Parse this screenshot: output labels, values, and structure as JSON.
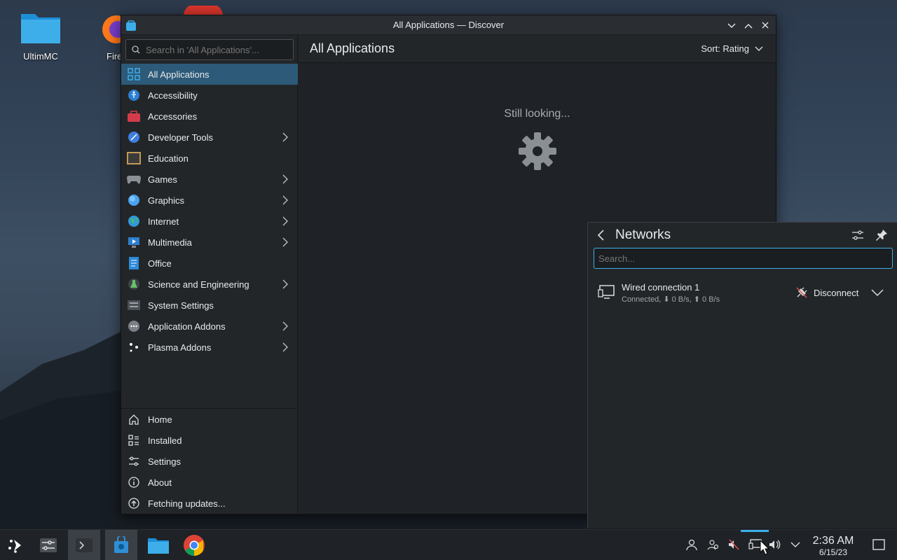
{
  "desktop": {
    "icons": [
      {
        "label": "UltimMC",
        "icon": "folder-icon"
      },
      {
        "label": "Fire",
        "icon": "firefox-icon"
      }
    ]
  },
  "window": {
    "title": "All Applications — Discover",
    "search_placeholder": "Search in 'All Applications'...",
    "categories": [
      {
        "label": "All Applications",
        "icon": "all-apps-icon",
        "submenu": false,
        "selected": true
      },
      {
        "label": "Accessibility",
        "icon": "accessibility-icon",
        "submenu": false
      },
      {
        "label": "Accessories",
        "icon": "accessories-icon",
        "submenu": false
      },
      {
        "label": "Developer Tools",
        "icon": "developer-tools-icon",
        "submenu": true
      },
      {
        "label": "Education",
        "icon": "education-icon",
        "submenu": false
      },
      {
        "label": "Games",
        "icon": "games-icon",
        "submenu": true
      },
      {
        "label": "Graphics",
        "icon": "graphics-icon",
        "submenu": true
      },
      {
        "label": "Internet",
        "icon": "internet-icon",
        "submenu": true
      },
      {
        "label": "Multimedia",
        "icon": "multimedia-icon",
        "submenu": true
      },
      {
        "label": "Office",
        "icon": "office-icon",
        "submenu": false
      },
      {
        "label": "Science and Engineering",
        "icon": "science-icon",
        "submenu": true
      },
      {
        "label": "System Settings",
        "icon": "system-settings-icon",
        "submenu": false
      },
      {
        "label": "Application Addons",
        "icon": "application-addons-icon",
        "submenu": true
      },
      {
        "label": "Plasma Addons",
        "icon": "plasma-addons-icon",
        "submenu": true
      }
    ],
    "bottom_nav": [
      {
        "label": "Home",
        "icon": "home-icon"
      },
      {
        "label": "Installed",
        "icon": "installed-icon"
      },
      {
        "label": "Settings",
        "icon": "settings-icon"
      },
      {
        "label": "About",
        "icon": "about-icon"
      },
      {
        "label": "Fetching updates...",
        "icon": "updates-icon"
      }
    ],
    "page_title": "All Applications",
    "sort_label": "Sort: Rating",
    "status_text": "Still looking..."
  },
  "networks": {
    "title": "Networks",
    "search_placeholder": "Search...",
    "connection": {
      "name": "Wired connection 1",
      "status": "Connected, ⬇ 0 B/s, ⬆ 0 B/s",
      "action": "Disconnect"
    }
  },
  "taskbar": {
    "time": "2:36 AM",
    "date": "6/15/23"
  },
  "colors": {
    "accent": "#3daee9",
    "selection": "#2d5a78",
    "window_bg": "#1f2226",
    "sidebar_bg": "#232629"
  }
}
